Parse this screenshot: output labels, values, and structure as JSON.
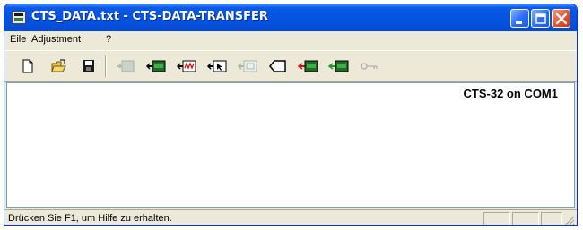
{
  "window": {
    "title": "CTS_DATA.txt - CTS-DATA-TRANSFER",
    "title_colors": {
      "bar": "#0553e0",
      "close": "#e0532f"
    }
  },
  "menu": {
    "items": [
      {
        "label": "File",
        "displayed": "Eile"
      },
      {
        "label": "Adjustment"
      },
      {
        "label": "?"
      }
    ]
  },
  "toolbar": {
    "tools": [
      {
        "icon": "new-document-icon",
        "enabled": true
      },
      {
        "icon": "open-folder-icon",
        "enabled": true
      },
      {
        "icon": "save-disk-icon",
        "enabled": true
      },
      {
        "icon": "send-disabled-icon",
        "enabled": false
      },
      {
        "icon": "transfer-data-icon",
        "enabled": true
      },
      {
        "icon": "measure-icon",
        "enabled": true
      },
      {
        "icon": "cursor-arrow-icon",
        "enabled": true
      },
      {
        "icon": "adjust-disabled-icon",
        "enabled": false
      },
      {
        "icon": "tag-icon",
        "enabled": true
      },
      {
        "icon": "transfer-red-icon",
        "enabled": true
      },
      {
        "icon": "transfer-green-icon",
        "enabled": true
      },
      {
        "icon": "key-disabled-icon",
        "enabled": false
      }
    ]
  },
  "content": {
    "connection_status": "CTS-32 on COM1"
  },
  "statusbar": {
    "text": "Drücken Sie F1, um Hilfe zu erhalten."
  }
}
